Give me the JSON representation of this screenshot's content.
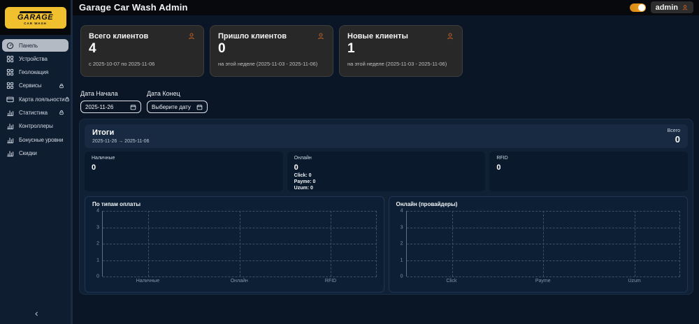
{
  "header": {
    "title": "Garage Car Wash Admin",
    "user": "admin"
  },
  "logo": {
    "title": "GARAGE",
    "subtitle": "CAR WASH"
  },
  "sidebar": {
    "items": [
      {
        "label": "Панель",
        "icon": "gauge-icon",
        "active": true,
        "locked": false
      },
      {
        "label": "Устройства",
        "icon": "grid-icon",
        "active": false,
        "locked": false
      },
      {
        "label": "Геолокация",
        "icon": "grid-icon",
        "active": false,
        "locked": false
      },
      {
        "label": "Сервисы",
        "icon": "grid-icon",
        "active": false,
        "locked": true
      },
      {
        "label": "Карта лояльности",
        "icon": "card-icon",
        "active": false,
        "locked": true
      },
      {
        "label": "Статистика",
        "icon": "bar-chart-icon",
        "active": false,
        "locked": true
      },
      {
        "label": "Контроллеры",
        "icon": "bar-chart-icon",
        "active": false,
        "locked": false
      },
      {
        "label": "Бонусные уровни",
        "icon": "bar-chart-icon",
        "active": false,
        "locked": false
      },
      {
        "label": "Скидки",
        "icon": "bar-chart-icon",
        "active": false,
        "locked": false
      }
    ]
  },
  "stat_cards": [
    {
      "title": "Всего клиентов",
      "value": "4",
      "subtitle": "с 2025-10-07 по 2025-11-06",
      "icon": "person-icon"
    },
    {
      "title": "Пришло клиентов",
      "value": "0",
      "subtitle": "на этой неделе (2025-11-03 - 2025-11-06)",
      "icon": "person-icon"
    },
    {
      "title": "Новые клиенты",
      "value": "1",
      "subtitle": "на этой неделе (2025-11-03 - 2025-11-06)",
      "icon": "person-icon"
    }
  ],
  "filters": {
    "start": {
      "label": "Дата Начала",
      "value": "2025-11-26"
    },
    "end": {
      "label": "Дата Конец",
      "placeholder": "Выберите дату"
    }
  },
  "summary": {
    "title": "Итоги",
    "range": "2025-11-26 → 2025-11-06",
    "total_label": "Всего",
    "total_value": "0",
    "boxes": [
      {
        "label": "Наличные",
        "value": "0",
        "details": []
      },
      {
        "label": "Онлайн",
        "value": "0",
        "details": [
          "Click: 0",
          "Payme: 0",
          "Uzum: 0"
        ]
      },
      {
        "label": "RFID",
        "value": "0",
        "details": []
      }
    ]
  },
  "chart_data": [
    {
      "type": "bar",
      "title": "По типам оплаты",
      "categories": [
        "Наличные",
        "Онлайн",
        "RFID"
      ],
      "values": [
        0,
        0,
        0
      ],
      "ylim": [
        0,
        4
      ],
      "yticks": [
        0,
        1,
        2,
        3,
        4
      ],
      "grid": true,
      "legend": false
    },
    {
      "type": "bar",
      "title": "Онлайн (провайдеры)",
      "categories": [
        "Click",
        "Payme",
        "Uzum"
      ],
      "values": [
        0,
        0,
        0
      ],
      "ylim": [
        0,
        4
      ],
      "yticks": [
        0,
        1,
        2,
        3,
        4
      ],
      "grid": true,
      "legend": false
    }
  ],
  "colors": {
    "logo_yellow": "#f0c02e",
    "accent_orange": "#b85c22",
    "toggle_on": "#f3a51e",
    "card_bg": "#282828",
    "panel_bg": "#102135"
  }
}
